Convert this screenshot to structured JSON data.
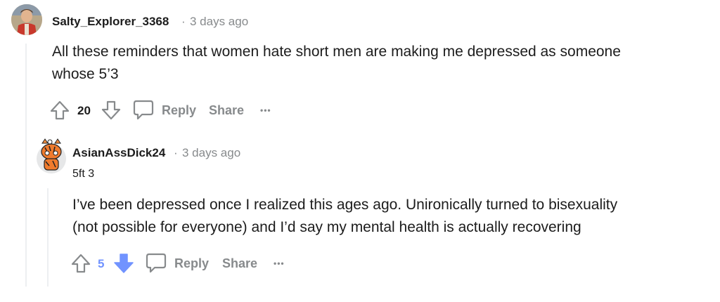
{
  "comment": {
    "username": "Salty_Explorer_3368",
    "separator": "·",
    "timestamp": "3 days ago",
    "body_line1": "All these reminders that women hate short men are making me depressed as someone",
    "body_line2": "whose 5’3",
    "score": "20",
    "reply_label": "Reply",
    "share_label": "Share",
    "more_label": "•••",
    "icons": {
      "upvote": "arrow-up-outline",
      "downvote": "arrow-down-outline",
      "reply": "speech-bubble"
    }
  },
  "reply": {
    "username": "AsianAssDick24",
    "separator": "·",
    "timestamp": "3 days ago",
    "flair": "5ft 3",
    "body_line1": "I’ve been depressed once I realized this ages ago. Unironically turned to bisexuality",
    "body_line2": "(not possible for everyone) and I’d say my mental health is actually recovering",
    "score": "5",
    "vote_state": "downvoted",
    "reply_label": "Reply",
    "share_label": "Share",
    "more_label": "•••",
    "icons": {
      "upvote": "arrow-up-outline",
      "downvote": "arrow-down-filled",
      "reply": "speech-bubble"
    }
  },
  "colors": {
    "meta_gray": "#878a8c",
    "downvote_blue": "#7193ff",
    "thread_line": "#edeff1"
  }
}
